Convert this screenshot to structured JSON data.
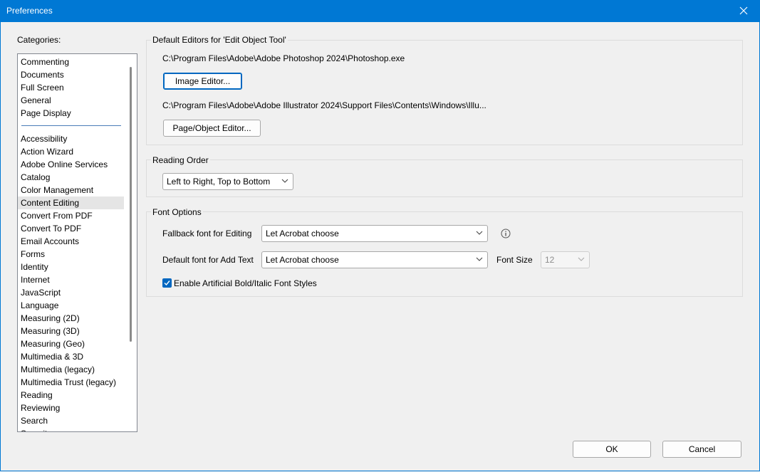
{
  "window": {
    "title": "Preferences"
  },
  "categories": {
    "label": "Categories:",
    "items": [
      "Commenting",
      "Documents",
      "Full Screen",
      "General",
      "Page Display",
      "Accessibility",
      "Action Wizard",
      "Adobe Online Services",
      "Catalog",
      "Color Management",
      "Content Editing",
      "Convert From PDF",
      "Convert To PDF",
      "Email Accounts",
      "Forms",
      "Identity",
      "Internet",
      "JavaScript",
      "Language",
      "Measuring (2D)",
      "Measuring (3D)",
      "Measuring (Geo)",
      "Multimedia & 3D",
      "Multimedia (legacy)",
      "Multimedia Trust (legacy)",
      "Reading",
      "Reviewing",
      "Search",
      "Security"
    ],
    "selected": "Content Editing"
  },
  "default_editors": {
    "title": "Default Editors for 'Edit Object Tool'",
    "image_path": "C:\\Program Files\\Adobe\\Adobe Photoshop 2024\\Photoshop.exe",
    "image_button": "Image Editor...",
    "page_path": "C:\\Program Files\\Adobe\\Adobe Illustrator 2024\\Support Files\\Contents\\Windows\\Illu...",
    "page_button": "Page/Object Editor..."
  },
  "reading_order": {
    "title": "Reading Order",
    "value": "Left to Right, Top to Bottom"
  },
  "font_options": {
    "title": "Font Options",
    "fallback_label": "Fallback font for Editing",
    "fallback_value": "Let Acrobat choose",
    "default_label": "Default font for Add Text",
    "default_value": "Let Acrobat choose",
    "size_label": "Font Size",
    "size_value": "12",
    "checkbox_label": "Enable Artificial Bold/Italic Font Styles",
    "checkbox_checked": true
  },
  "footer": {
    "ok": "OK",
    "cancel": "Cancel"
  },
  "colors": {
    "accent": "#0078d4",
    "check": "#0067c0"
  }
}
